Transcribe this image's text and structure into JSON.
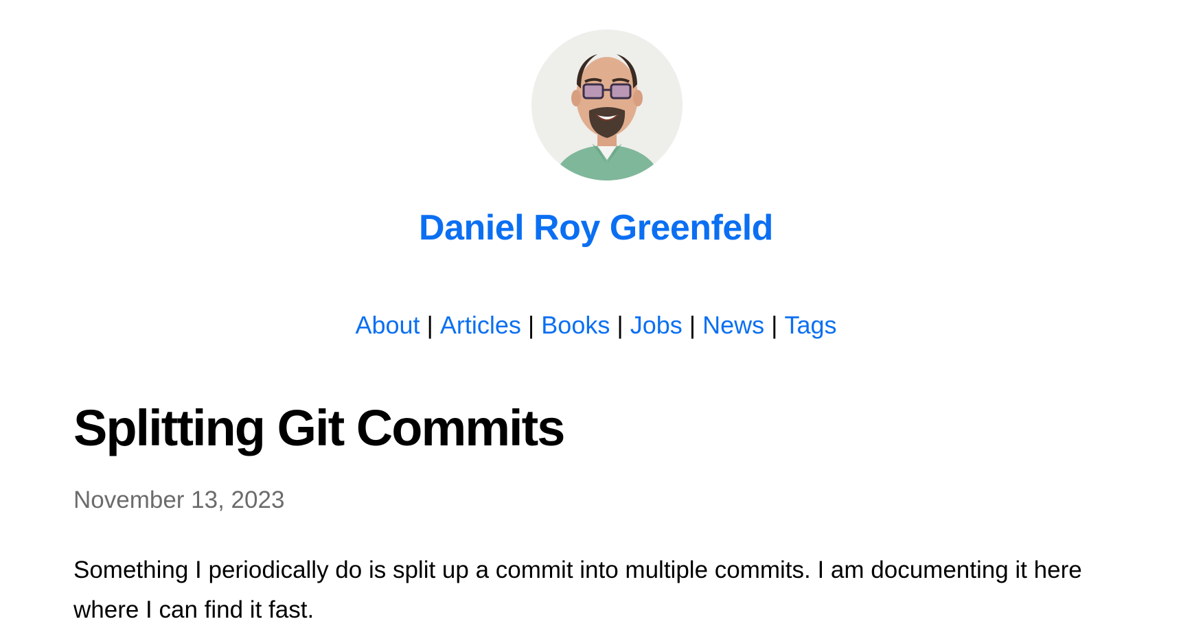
{
  "header": {
    "avatar_alt": "Daniel Roy Greenfeld",
    "site_title": "Daniel Roy Greenfeld",
    "nav": [
      {
        "label": "About"
      },
      {
        "label": "Articles"
      },
      {
        "label": "Books"
      },
      {
        "label": "Jobs"
      },
      {
        "label": "News"
      },
      {
        "label": "Tags"
      }
    ],
    "nav_separator": "|"
  },
  "post": {
    "title": "Splitting Git Commits",
    "date": "November 13, 2023",
    "intro": "Something I periodically do is split up a commit into multiple commits. I am documenting it here where I can find it fast."
  },
  "colors": {
    "link": "#0b6ff2",
    "text": "#000000",
    "muted": "#6b6b6b",
    "background": "#ffffff"
  }
}
